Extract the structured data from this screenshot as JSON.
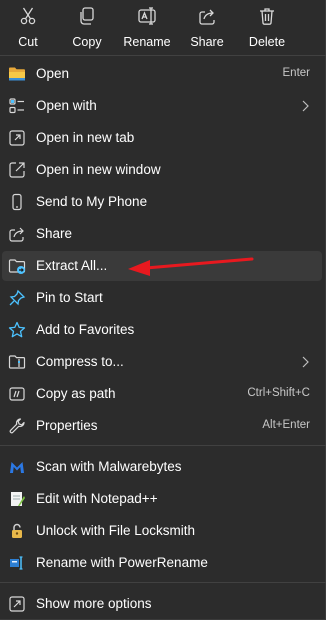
{
  "toolbar": {
    "cut": {
      "label": "Cut",
      "icon": "scissors-icon"
    },
    "copy": {
      "label": "Copy",
      "icon": "copy-icon"
    },
    "rename": {
      "label": "Rename",
      "icon": "rename-icon"
    },
    "share": {
      "label": "Share",
      "icon": "share-icon"
    },
    "delete": {
      "label": "Delete",
      "icon": "trash-icon"
    }
  },
  "menu": {
    "items": [
      {
        "label": "Open",
        "shortcut": "Enter",
        "icon": "folder-icon"
      },
      {
        "label": "Open with",
        "submenu": true,
        "icon": "open-with-icon"
      },
      {
        "label": "Open in new tab",
        "icon": "new-tab-icon"
      },
      {
        "label": "Open in new window",
        "icon": "new-window-icon"
      },
      {
        "label": "Send to My Phone",
        "icon": "phone-icon"
      },
      {
        "label": "Share",
        "icon": "share-icon"
      },
      {
        "label": "Extract All...",
        "icon": "extract-icon",
        "highlighted": true
      },
      {
        "label": "Pin to Start",
        "icon": "pin-icon"
      },
      {
        "label": "Add to Favorites",
        "icon": "star-icon"
      },
      {
        "label": "Compress to...",
        "submenu": true,
        "icon": "compress-icon"
      },
      {
        "label": "Copy as path",
        "shortcut": "Ctrl+Shift+C",
        "icon": "copy-path-icon"
      },
      {
        "label": "Properties",
        "shortcut": "Alt+Enter",
        "icon": "wrench-icon"
      },
      {
        "label": "Scan with Malwarebytes",
        "icon": "malwarebytes-icon"
      },
      {
        "label": "Edit with Notepad++",
        "icon": "notepadpp-icon"
      },
      {
        "label": "Unlock with File Locksmith",
        "icon": "lock-icon"
      },
      {
        "label": "Rename with PowerRename",
        "icon": "powerrename-icon"
      },
      {
        "label": "Show more options",
        "icon": "more-options-icon"
      }
    ]
  },
  "colors": {
    "background": "#2c2c2c",
    "highlight": "#3a3a3a",
    "accent": "#4cc2ff",
    "annotation_arrow": "#e8191f"
  }
}
